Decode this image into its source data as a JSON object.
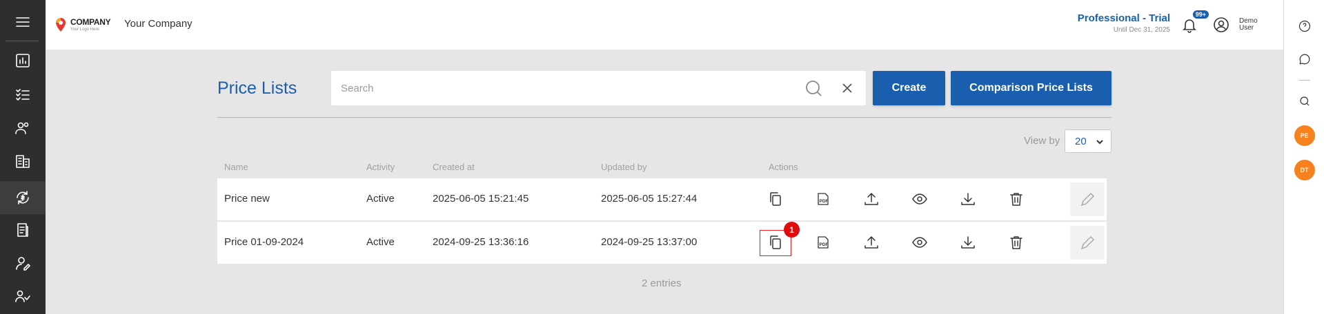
{
  "header": {
    "logo_text": "COMPANY",
    "logo_tagline": "Your Logo Here",
    "company_name": "Your Company",
    "plan_title": "Professional - Trial",
    "plan_until": "Until Dec 31, 2025",
    "notifications_badge": "99+",
    "user_first": "Demo",
    "user_last": "User"
  },
  "page": {
    "title": "Price Lists",
    "search_placeholder": "Search",
    "create_label": "Create",
    "comparison_label": "Comparison Price Lists",
    "view_by_label": "View by",
    "view_by_value": "20",
    "entries_text": "2 entries"
  },
  "table": {
    "columns": [
      "Name",
      "Activity",
      "Created at",
      "Updated by",
      "Actions"
    ],
    "rows": [
      {
        "name": "Price new",
        "activity": "Active",
        "created": "2025-06-05 15:21:45",
        "updated": "2025-06-05 15:27:44"
      },
      {
        "name": "Price 01-09-2024",
        "activity": "Active",
        "created": "2024-09-25 13:36:16",
        "updated": "2024-09-25 13:37:00"
      }
    ],
    "action_icons": [
      "copy-icon",
      "pdf-icon",
      "upload-icon",
      "eye-icon",
      "download-icon",
      "trash-icon",
      "pencil-icon"
    ]
  },
  "annotation": {
    "marker_label": "1"
  },
  "right_rail": {
    "avatars": [
      "PE",
      "DT"
    ]
  },
  "colors": {
    "accent": "#1a5fad",
    "sidebar": "#2e2e2e",
    "avatar": "#f5821f",
    "marker": "#e00b0b"
  }
}
